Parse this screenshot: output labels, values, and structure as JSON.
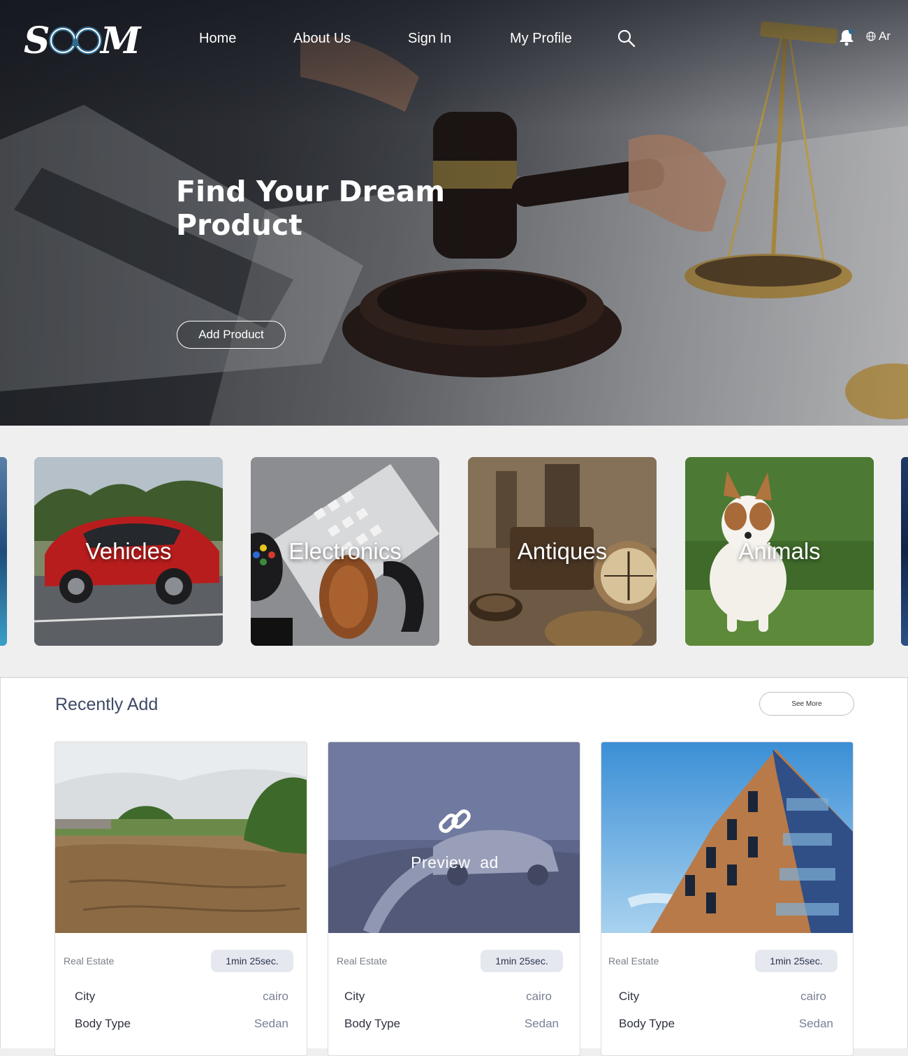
{
  "brand": {
    "logo_text": "SOOM"
  },
  "nav": {
    "items": [
      {
        "label": "Home"
      },
      {
        "label": "About Us"
      },
      {
        "label": "Sign In"
      },
      {
        "label": "My Profile"
      }
    ],
    "language_label": "Ar"
  },
  "hero": {
    "title": "Find Your Dream Product",
    "cta_label": "Add Product"
  },
  "categories": [
    {
      "label": "Vehicles"
    },
    {
      "label": "Electronics"
    },
    {
      "label": "Antiques"
    },
    {
      "label": "Animals"
    }
  ],
  "recent": {
    "title": "Recently Add",
    "see_more_label": "See More",
    "preview_label": "Preview  ad",
    "listings": [
      {
        "category": "Real Estate",
        "time": "1min 25sec.",
        "city_label": "City",
        "city": "cairo",
        "body_label": "Body Type",
        "body": "Sedan"
      },
      {
        "category": "Real Estate",
        "time": "1min 25sec.",
        "city_label": "City",
        "city": "cairo",
        "body_label": "Body Type",
        "body": "Sedan"
      },
      {
        "category": "Real Estate",
        "time": "1min 25sec.",
        "city_label": "City",
        "city": "cairo",
        "body_label": "Body Type",
        "body": "Sedan"
      }
    ]
  },
  "colors": {
    "title_navy": "#3f4a66",
    "badge_bg": "#e6e8ef",
    "value_gray": "#7a8095"
  }
}
